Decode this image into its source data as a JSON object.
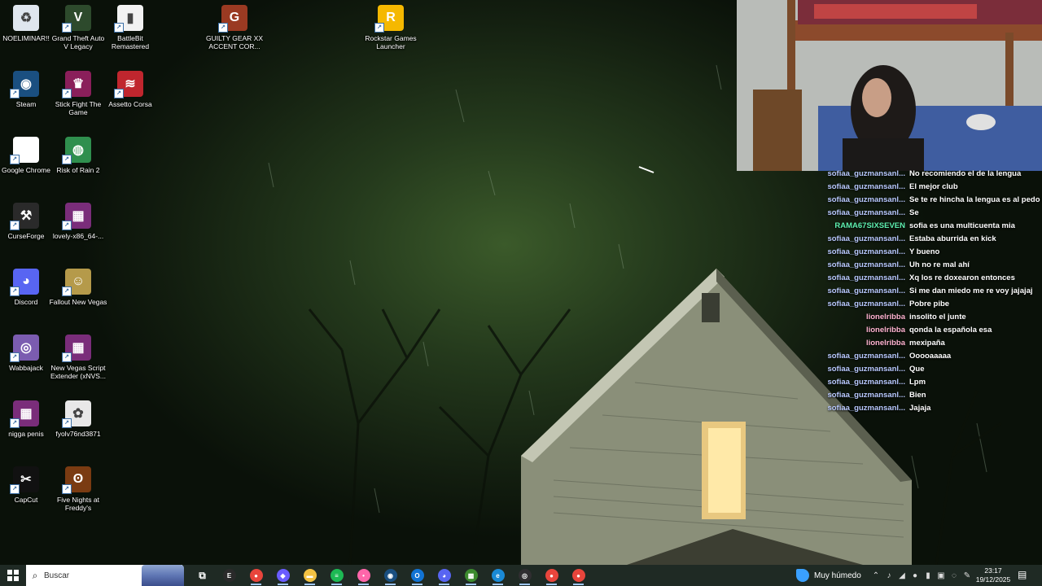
{
  "desktop_icons": [
    {
      "label": "NOELIMINAR!!",
      "icon": "recycle-bin-icon",
      "color": "#dfe6ee",
      "glyph": "♻"
    },
    {
      "label": "Grand Theft Auto V Legacy",
      "icon": "gta-icon",
      "color": "#2d4a2c",
      "glyph": "V"
    },
    {
      "label": "BattleBit Remastered",
      "icon": "battlebit-icon",
      "color": "#f2f2f2",
      "glyph": "▮"
    },
    {
      "label": "GUILTY GEAR XX ACCENT COR...",
      "icon": "guilty-gear-icon",
      "color": "#9a3a22",
      "glyph": "G"
    },
    {
      "label": "Rockstar Games Launcher",
      "icon": "rockstar-icon",
      "color": "#f5b800",
      "glyph": "R"
    },
    {
      "label": "Steam",
      "icon": "steam-icon",
      "color": "#1a4f80",
      "glyph": "◉"
    },
    {
      "label": "Stick Fight The Game",
      "icon": "stick-fight-icon",
      "color": "#8a1f5a",
      "glyph": "♛"
    },
    {
      "label": "Assetto Corsa",
      "icon": "assetto-corsa-icon",
      "color": "#c0262e",
      "glyph": "≋"
    },
    {
      "label": "Google Chrome",
      "icon": "file-icon",
      "color": "#ffffff",
      "glyph": ""
    },
    {
      "label": "Risk of Rain 2",
      "icon": "globe-icon",
      "color": "#2f8f4e",
      "glyph": "◍"
    },
    {
      "label": "CurseForge",
      "icon": "curseforge-icon",
      "color": "#2a2a2a",
      "glyph": "⚒"
    },
    {
      "label": "lovely-x86_64-...",
      "icon": "winrar-icon",
      "color": "#7a2d7a",
      "glyph": "▦"
    },
    {
      "label": "Discord",
      "icon": "discord-icon",
      "color": "#5865f2",
      "glyph": "◕"
    },
    {
      "label": "Fallout New Vegas",
      "icon": "fallout-icon",
      "color": "#b59a4a",
      "glyph": "☺"
    },
    {
      "label": "Wabbajack",
      "icon": "wabbajack-icon",
      "color": "#7b5cb0",
      "glyph": "◎"
    },
    {
      "label": "New Vegas Script Extender (xNVS...",
      "icon": "winrar-icon",
      "color": "#7a2d7a",
      "glyph": "▦"
    },
    {
      "label": "nigga penis",
      "icon": "winrar-icon",
      "color": "#7a2d7a",
      "glyph": "▦"
    },
    {
      "label": "fyolv76nd3871",
      "icon": "image-file-icon",
      "color": "#e8e8e8",
      "glyph": "✿"
    },
    {
      "label": "CapCut",
      "icon": "capcut-icon",
      "color": "#111111",
      "glyph": "✂"
    },
    {
      "label": "Five Nights at Freddy's",
      "icon": "fnaf-icon",
      "color": "#7a3b12",
      "glyph": "ʘ"
    }
  ],
  "chat": [
    {
      "user": "sofiaa_guzmansanl...",
      "msg": "No recomiendo el de la lengua",
      "color": "#b9c9ff"
    },
    {
      "user": "sofiaa_guzmansanl...",
      "msg": "El mejor club",
      "color": "#b9c9ff"
    },
    {
      "user": "sofiaa_guzmansanl...",
      "msg": "Se te re hincha la lengua es al pedo",
      "color": "#b9c9ff"
    },
    {
      "user": "sofiaa_guzmansanl...",
      "msg": "Se",
      "color": "#b9c9ff"
    },
    {
      "user": "RAMA67SIXSEVEN",
      "msg": "sofia es una multicuenta mia",
      "color": "#5ef0b0"
    },
    {
      "user": "sofiaa_guzmansanl...",
      "msg": "Estaba aburrida en kick",
      "color": "#b9c9ff"
    },
    {
      "user": "sofiaa_guzmansanl...",
      "msg": "Y bueno",
      "color": "#b9c9ff"
    },
    {
      "user": "sofiaa_guzmansanl...",
      "msg": "Uh no re mal ahí",
      "color": "#b9c9ff"
    },
    {
      "user": "sofiaa_guzmansanl...",
      "msg": "Xq los re doxearon entonces",
      "color": "#b9c9ff"
    },
    {
      "user": "sofiaa_guzmansanl...",
      "msg": "Si me dan miedo me re voy jajajaj",
      "color": "#b9c9ff"
    },
    {
      "user": "sofiaa_guzmansanl...",
      "msg": "Pobre pibe",
      "color": "#b9c9ff"
    },
    {
      "user": "lionelribba",
      "msg": "insolito el junte",
      "color": "#ffb3d0"
    },
    {
      "user": "lionelribba",
      "msg": "qonda la española esa",
      "color": "#ffb3d0"
    },
    {
      "user": "lionelribba",
      "msg": "mexipaña",
      "color": "#ffb3d0"
    },
    {
      "user": "sofiaa_guzmansanl...",
      "msg": "Ooooaaaaa",
      "color": "#b9c9ff"
    },
    {
      "user": "sofiaa_guzmansanl...",
      "msg": "Que",
      "color": "#b9c9ff"
    },
    {
      "user": "sofiaa_guzmansanl...",
      "msg": "Lpm",
      "color": "#b9c9ff"
    },
    {
      "user": "sofiaa_guzmansanl...",
      "msg": "Bien",
      "color": "#b9c9ff"
    },
    {
      "user": "sofiaa_guzmansanl...",
      "msg": "Jajaja",
      "color": "#b9c9ff"
    }
  ],
  "taskbar": {
    "search_placeholder": "Buscar",
    "apps": [
      {
        "name": "task-view-icon",
        "color": "transparent",
        "glyph": "⧉"
      },
      {
        "name": "epic-games-icon",
        "color": "#2a2a2a",
        "glyph": "E"
      },
      {
        "name": "chrome-icon",
        "color": "#e8453c",
        "glyph": "●"
      },
      {
        "name": "copilot-icon",
        "color": "#6a5cff",
        "glyph": "◆"
      },
      {
        "name": "file-explorer-icon",
        "color": "#f3c243",
        "glyph": "▬"
      },
      {
        "name": "spotify-icon",
        "color": "#1db954",
        "glyph": "≡"
      },
      {
        "name": "osu-icon",
        "color": "#ff66aa",
        "glyph": "•"
      },
      {
        "name": "steam-icon",
        "color": "#1a4f80",
        "glyph": "◉"
      },
      {
        "name": "outlook-icon",
        "color": "#1173d4",
        "glyph": "O"
      },
      {
        "name": "discord-icon",
        "color": "#5865f2",
        "glyph": "◕"
      },
      {
        "name": "minecraft-icon",
        "color": "#3c8a2e",
        "glyph": "▩"
      },
      {
        "name": "edge-icon",
        "color": "#1a8ad6",
        "glyph": "e"
      },
      {
        "name": "obs-icon",
        "color": "#302e31",
        "glyph": "◎"
      },
      {
        "name": "chrome-profile-icon",
        "color": "#e8453c",
        "glyph": "●"
      },
      {
        "name": "chrome-profile-2-icon",
        "color": "#e8453c",
        "glyph": "●"
      }
    ],
    "weather": "Muy húmedo",
    "time": "23:17",
    "date": "19/12/2025"
  }
}
